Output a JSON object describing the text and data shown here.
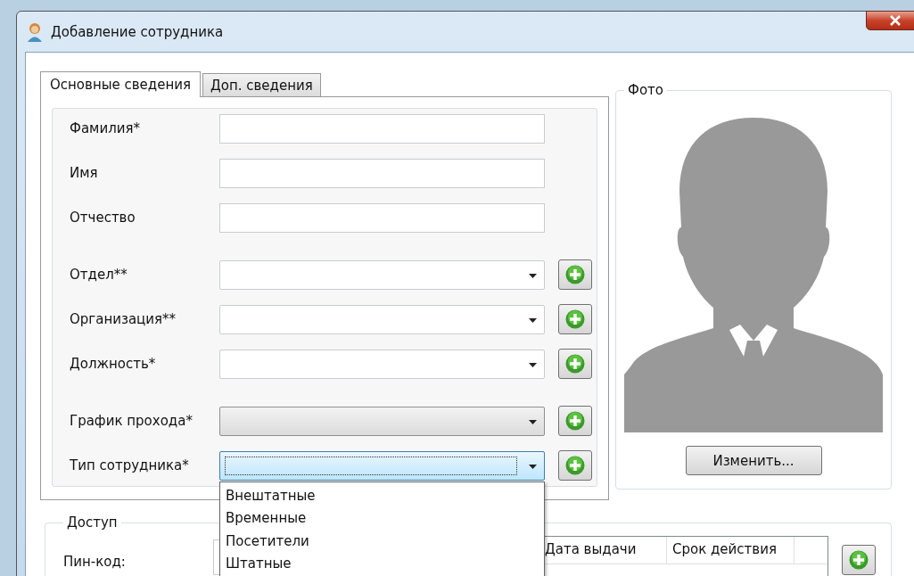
{
  "window": {
    "title": "Добавление сотрудника"
  },
  "tabs": [
    {
      "label": "Основные сведения",
      "selected": true
    },
    {
      "label": "Доп. сведения",
      "selected": false
    }
  ],
  "field_groups": [
    [
      {
        "label": "Фамилия*",
        "kind": "text"
      },
      {
        "label": "Имя",
        "kind": "text"
      },
      {
        "label": "Отчество",
        "kind": "text"
      }
    ],
    [
      {
        "label": "Отдел**",
        "kind": "combo",
        "editable": true
      },
      {
        "label": "Организация**",
        "kind": "combo",
        "editable": true
      },
      {
        "label": "Должность*",
        "kind": "combo",
        "editable": true
      }
    ],
    [
      {
        "label": "График прохода*",
        "kind": "combo",
        "editable": false
      },
      {
        "label": "Тип сотрудника*",
        "kind": "combo",
        "editable": false,
        "expanded": true,
        "options": [
          "Внештатные",
          "Временные",
          "Посетители",
          "Штатные"
        ]
      }
    ]
  ],
  "photo": {
    "legend": "Фото",
    "change_button": "Изменить..."
  },
  "access": {
    "legend": "Доступ",
    "pin_label": "Пин-код:",
    "columns": [
      "Дата выдачи",
      "Срок действия"
    ]
  }
}
